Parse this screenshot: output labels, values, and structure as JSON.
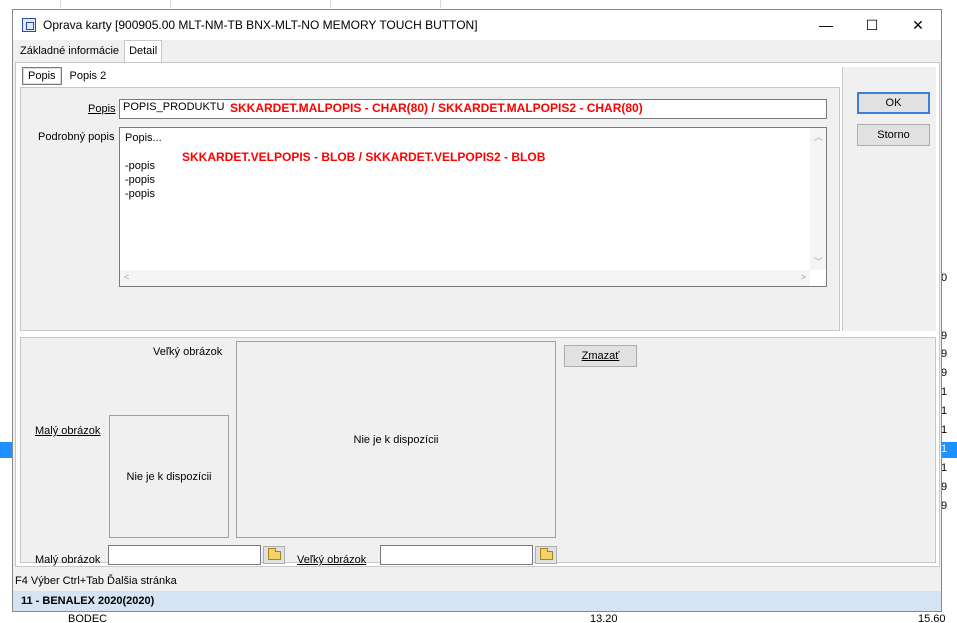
{
  "window": {
    "title": "Oprava karty [900905.00  MLT-NM-TB  BNX-MLT-NO MEMORY TOUCH BUTTON]",
    "minimize": "—",
    "maximize": "☐",
    "close": "✕"
  },
  "tabs": {
    "main": [
      "Základné informácie",
      "Detail"
    ],
    "sub": [
      "Popis",
      "Popis 2"
    ]
  },
  "popis": {
    "label": "Popis",
    "value": "POPIS_PRODUKTU",
    "annotation": "SKKARDET.MALPOPIS - CHAR(80)  /  SKKARDET.MALPOPIS2 - CHAR(80)"
  },
  "podrobny": {
    "label": "Podrobný popis",
    "lines": [
      "Popis...",
      "",
      "-popis",
      "-popis",
      "-popis"
    ],
    "annotation": "SKKARDET.VELPOPIS - BLOB  /  SKKARDET.VELPOPIS2 - BLOB"
  },
  "buttons": {
    "ok": "OK",
    "storno": "Storno",
    "zmazat": "Zmazať"
  },
  "images": {
    "velky_label": "Veľký obrázok",
    "maly_label": "Malý obrázok",
    "placeholder": "Nie je k dispozícii",
    "maly_path_label": "Malý obrázok",
    "velky_path_label": "Veľký obrázok",
    "maly_path": "",
    "velky_path": ""
  },
  "status": {
    "shortcuts": "F4 Výber Ctrl+Tab Ďalšia stránka",
    "company": "11 - BENALEX 2020(2020)"
  },
  "background": {
    "right_digits": [
      "0",
      "9",
      "9",
      "9",
      "1",
      "1",
      "1",
      "1",
      "1",
      "9",
      "9"
    ],
    "bottom_left": "BODEC",
    "bottom_mid": "13.20",
    "bottom_right": "15.60"
  }
}
